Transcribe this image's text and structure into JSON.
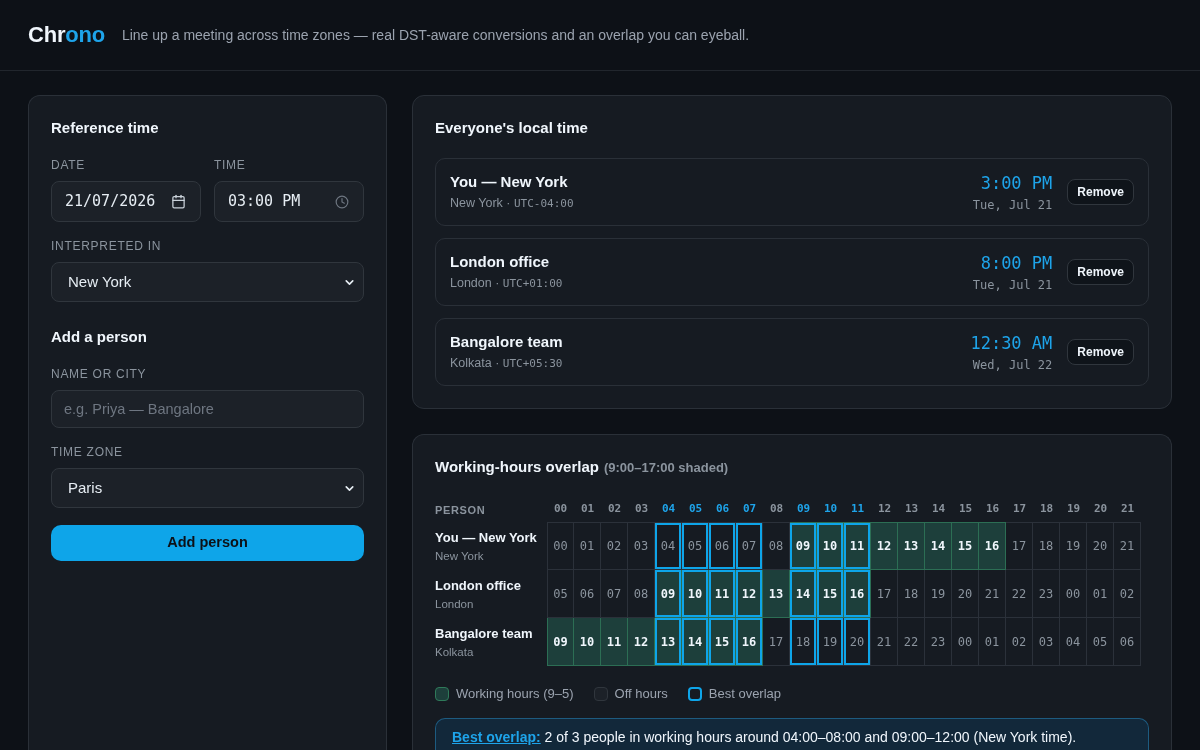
{
  "header": {
    "logo": {
      "start": "Chr",
      "accent": "ono"
    },
    "tagline": "Line up a meeting across time zones — real DST-aware conversions and an overlap you can eyeball."
  },
  "reference": {
    "title": "Reference time",
    "fields": [
      {
        "kind": "date",
        "label": "DATE",
        "value": "21/07/2026"
      },
      {
        "kind": "time",
        "label": "TIME",
        "value": "03:00 PM"
      }
    ],
    "zone": {
      "label": "INTERPRETED IN",
      "value": "New York"
    }
  },
  "add_person": {
    "title": "Add a person",
    "name_field": {
      "label": "NAME OR CITY",
      "placeholder": "e.g. Priya — Bangalore"
    },
    "zone": {
      "label": "TIME ZONE",
      "value": "Paris"
    },
    "button": "Add person"
  },
  "local_times": {
    "title": "Everyone's local time",
    "people": [
      {
        "name": "You — New York",
        "location": "New York ·",
        "utc_offset": "UTC-04:00",
        "time": "3:00 PM",
        "date": "Tue, Jul 21",
        "button": "Remove"
      },
      {
        "name": "London office",
        "location": "London ·",
        "utc_offset": "UTC+01:00",
        "time": "8:00 PM",
        "date": "Tue, Jul 21",
        "button": "Remove"
      },
      {
        "name": "Bangalore team",
        "location": "Kolkata ·",
        "utc_offset": "UTC+05:30",
        "time": "12:30 AM",
        "date": "Wed, Jul 22",
        "button": "Remove"
      }
    ]
  },
  "overlap": {
    "title": "Working-hours overlap",
    "note": "(9:00–17:00 shaded)",
    "person_heading": "PERSON",
    "hours": [
      {
        "label": "00",
        "best": false
      },
      {
        "label": "01",
        "best": false
      },
      {
        "label": "02",
        "best": false
      },
      {
        "label": "03",
        "best": false
      },
      {
        "label": "04",
        "best": true
      },
      {
        "label": "05",
        "best": true
      },
      {
        "label": "06",
        "best": true
      },
      {
        "label": "07",
        "best": true
      },
      {
        "label": "08",
        "best": false
      },
      {
        "label": "09",
        "best": true
      },
      {
        "label": "10",
        "best": true
      },
      {
        "label": "11",
        "best": true
      },
      {
        "label": "12",
        "best": false
      },
      {
        "label": "13",
        "best": false
      },
      {
        "label": "14",
        "best": false
      },
      {
        "label": "15",
        "best": false
      },
      {
        "label": "16",
        "best": false
      },
      {
        "label": "17",
        "best": false
      },
      {
        "label": "18",
        "best": false
      },
      {
        "label": "19",
        "best": false
      },
      {
        "label": "20",
        "best": false
      },
      {
        "label": "21",
        "best": false
      }
    ],
    "rows": [
      {
        "name": "You — New York",
        "place": "New York",
        "cells": [
          {
            "text": "00",
            "working": false,
            "best": false
          },
          {
            "text": "01",
            "working": false,
            "best": false
          },
          {
            "text": "02",
            "working": false,
            "best": false
          },
          {
            "text": "03",
            "working": false,
            "best": false
          },
          {
            "text": "04",
            "working": false,
            "best": true
          },
          {
            "text": "05",
            "working": false,
            "best": true
          },
          {
            "text": "06",
            "working": false,
            "best": true
          },
          {
            "text": "07",
            "working": false,
            "best": true
          },
          {
            "text": "08",
            "working": false,
            "best": false
          },
          {
            "text": "09",
            "working": true,
            "best": true
          },
          {
            "text": "10",
            "working": true,
            "best": true
          },
          {
            "text": "11",
            "working": true,
            "best": true
          },
          {
            "text": "12",
            "working": true,
            "best": false
          },
          {
            "text": "13",
            "working": true,
            "best": false
          },
          {
            "text": "14",
            "working": true,
            "best": false
          },
          {
            "text": "15",
            "working": true,
            "best": false
          },
          {
            "text": "16",
            "working": true,
            "best": false
          },
          {
            "text": "17",
            "working": false,
            "best": false
          },
          {
            "text": "18",
            "working": false,
            "best": false
          },
          {
            "text": "19",
            "working": false,
            "best": false
          },
          {
            "text": "20",
            "working": false,
            "best": false
          },
          {
            "text": "21",
            "working": false,
            "best": false
          }
        ]
      },
      {
        "name": "London office",
        "place": "London",
        "cells": [
          {
            "text": "05",
            "working": false,
            "best": false
          },
          {
            "text": "06",
            "working": false,
            "best": false
          },
          {
            "text": "07",
            "working": false,
            "best": false
          },
          {
            "text": "08",
            "working": false,
            "best": false
          },
          {
            "text": "09",
            "working": true,
            "best": true
          },
          {
            "text": "10",
            "working": true,
            "best": true
          },
          {
            "text": "11",
            "working": true,
            "best": true
          },
          {
            "text": "12",
            "working": true,
            "best": true
          },
          {
            "text": "13",
            "working": true,
            "best": false
          },
          {
            "text": "14",
            "working": true,
            "best": true
          },
          {
            "text": "15",
            "working": true,
            "best": true
          },
          {
            "text": "16",
            "working": true,
            "best": true
          },
          {
            "text": "17",
            "working": false,
            "best": false
          },
          {
            "text": "18",
            "working": false,
            "best": false
          },
          {
            "text": "19",
            "working": false,
            "best": false
          },
          {
            "text": "20",
            "working": false,
            "best": false
          },
          {
            "text": "21",
            "working": false,
            "best": false
          },
          {
            "text": "22",
            "working": false,
            "best": false
          },
          {
            "text": "23",
            "working": false,
            "best": false
          },
          {
            "text": "00",
            "working": false,
            "best": false
          },
          {
            "text": "01",
            "working": false,
            "best": false
          },
          {
            "text": "02",
            "working": false,
            "best": false
          }
        ]
      },
      {
        "name": "Bangalore team",
        "place": "Kolkata",
        "cells": [
          {
            "text": "09",
            "working": true,
            "best": false
          },
          {
            "text": "10",
            "working": true,
            "best": false
          },
          {
            "text": "11",
            "working": true,
            "best": false
          },
          {
            "text": "12",
            "working": true,
            "best": false
          },
          {
            "text": "13",
            "working": true,
            "best": true
          },
          {
            "text": "14",
            "working": true,
            "best": true
          },
          {
            "text": "15",
            "working": true,
            "best": true
          },
          {
            "text": "16",
            "working": true,
            "best": true
          },
          {
            "text": "17",
            "working": false,
            "best": false
          },
          {
            "text": "18",
            "working": false,
            "best": true
          },
          {
            "text": "19",
            "working": false,
            "best": true
          },
          {
            "text": "20",
            "working": false,
            "best": true
          },
          {
            "text": "21",
            "working": false,
            "best": false
          },
          {
            "text": "22",
            "working": false,
            "best": false
          },
          {
            "text": "23",
            "working": false,
            "best": false
          },
          {
            "text": "00",
            "working": false,
            "best": false
          },
          {
            "text": "01",
            "working": false,
            "best": false
          },
          {
            "text": "02",
            "working": false,
            "best": false
          },
          {
            "text": "03",
            "working": false,
            "best": false
          },
          {
            "text": "04",
            "working": false,
            "best": false
          },
          {
            "text": "05",
            "working": false,
            "best": false
          },
          {
            "text": "06",
            "working": false,
            "best": false
          }
        ]
      }
    ],
    "legend": [
      {
        "kind": "working",
        "label": "Working hours (9–5)"
      },
      {
        "kind": "off",
        "label": "Off hours"
      },
      {
        "kind": "best",
        "label": "Best overlap"
      }
    ],
    "summary": {
      "label": "Best overlap:",
      "text": "2 of 3 people in working hours around 04:00–08:00 and 09:00–12:00 (New York time)."
    }
  }
}
